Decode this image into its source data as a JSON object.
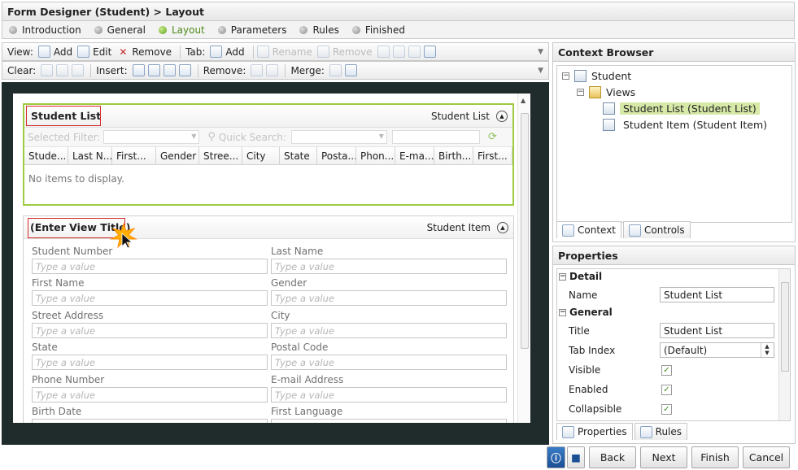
{
  "window": {
    "title": "Form Designer (Student) > Layout"
  },
  "steps": [
    {
      "label": "Introduction",
      "active": false
    },
    {
      "label": "General",
      "active": false
    },
    {
      "label": "Layout",
      "active": true
    },
    {
      "label": "Parameters",
      "active": false
    },
    {
      "label": "Rules",
      "active": false
    },
    {
      "label": "Finished",
      "active": false
    }
  ],
  "toolbar1": {
    "view_label": "View:",
    "view_add": "Add",
    "view_edit": "Edit",
    "view_remove": "Remove",
    "tab_label": "Tab:",
    "tab_add": "Add",
    "tab_rename": "Rename",
    "tab_remove": "Remove"
  },
  "toolbar2": {
    "clear_label": "Clear:",
    "insert_label": "Insert:",
    "remove_label": "Remove:",
    "merge_label": "Merge:"
  },
  "view1": {
    "title": "Student List",
    "type": "Student List",
    "filter_label": "Selected Filter:",
    "search_label": "Quick Search:",
    "columns": [
      "Stude...",
      "Last N...",
      "First...",
      "Gender",
      "Stree...",
      "City",
      "State",
      "Posta...",
      "Phon...",
      "E-ma...",
      "Birth...",
      "First..."
    ],
    "empty_text": "No items to display."
  },
  "view2": {
    "title": "(Enter View Title)",
    "type": "Student Item",
    "placeholder": "Type a value",
    "fields": [
      {
        "label": "Student Number"
      },
      {
        "label": "Last Name"
      },
      {
        "label": "First Name"
      },
      {
        "label": "Gender"
      },
      {
        "label": "Street Address"
      },
      {
        "label": "City"
      },
      {
        "label": "State"
      },
      {
        "label": "Postal Code"
      },
      {
        "label": "Phone Number"
      },
      {
        "label": "E-mail Address"
      },
      {
        "label": "Birth Date"
      },
      {
        "label": "First Language"
      }
    ]
  },
  "context": {
    "title": "Context Browser",
    "root": "Student",
    "views": "Views",
    "items": [
      "Student List (Student List)",
      "Student Item (Student Item)"
    ],
    "tabs": [
      "Context",
      "Controls"
    ]
  },
  "properties": {
    "title": "Properties",
    "sections": [
      "Detail",
      "General"
    ],
    "rows": {
      "name_label": "Name",
      "name_value": "Student List",
      "title_label": "Title",
      "title_value": "Student List",
      "tabindex_label": "Tab Index",
      "tabindex_value": "(Default)",
      "visible_label": "Visible",
      "enabled_label": "Enabled",
      "collapsible_label": "Collapsible"
    },
    "checks": {
      "visible": true,
      "enabled": true,
      "collapsible": true
    },
    "tabs": [
      "Properties",
      "Rules"
    ]
  },
  "footer": {
    "back": "Back",
    "next": "Next",
    "finish": "Finish",
    "cancel": "Cancel"
  },
  "colors": {
    "accent_green": "#9ecb42",
    "highlight": "#d42a2a",
    "canvas_bg": "#202b2c",
    "selection": "#d7e9a7"
  }
}
